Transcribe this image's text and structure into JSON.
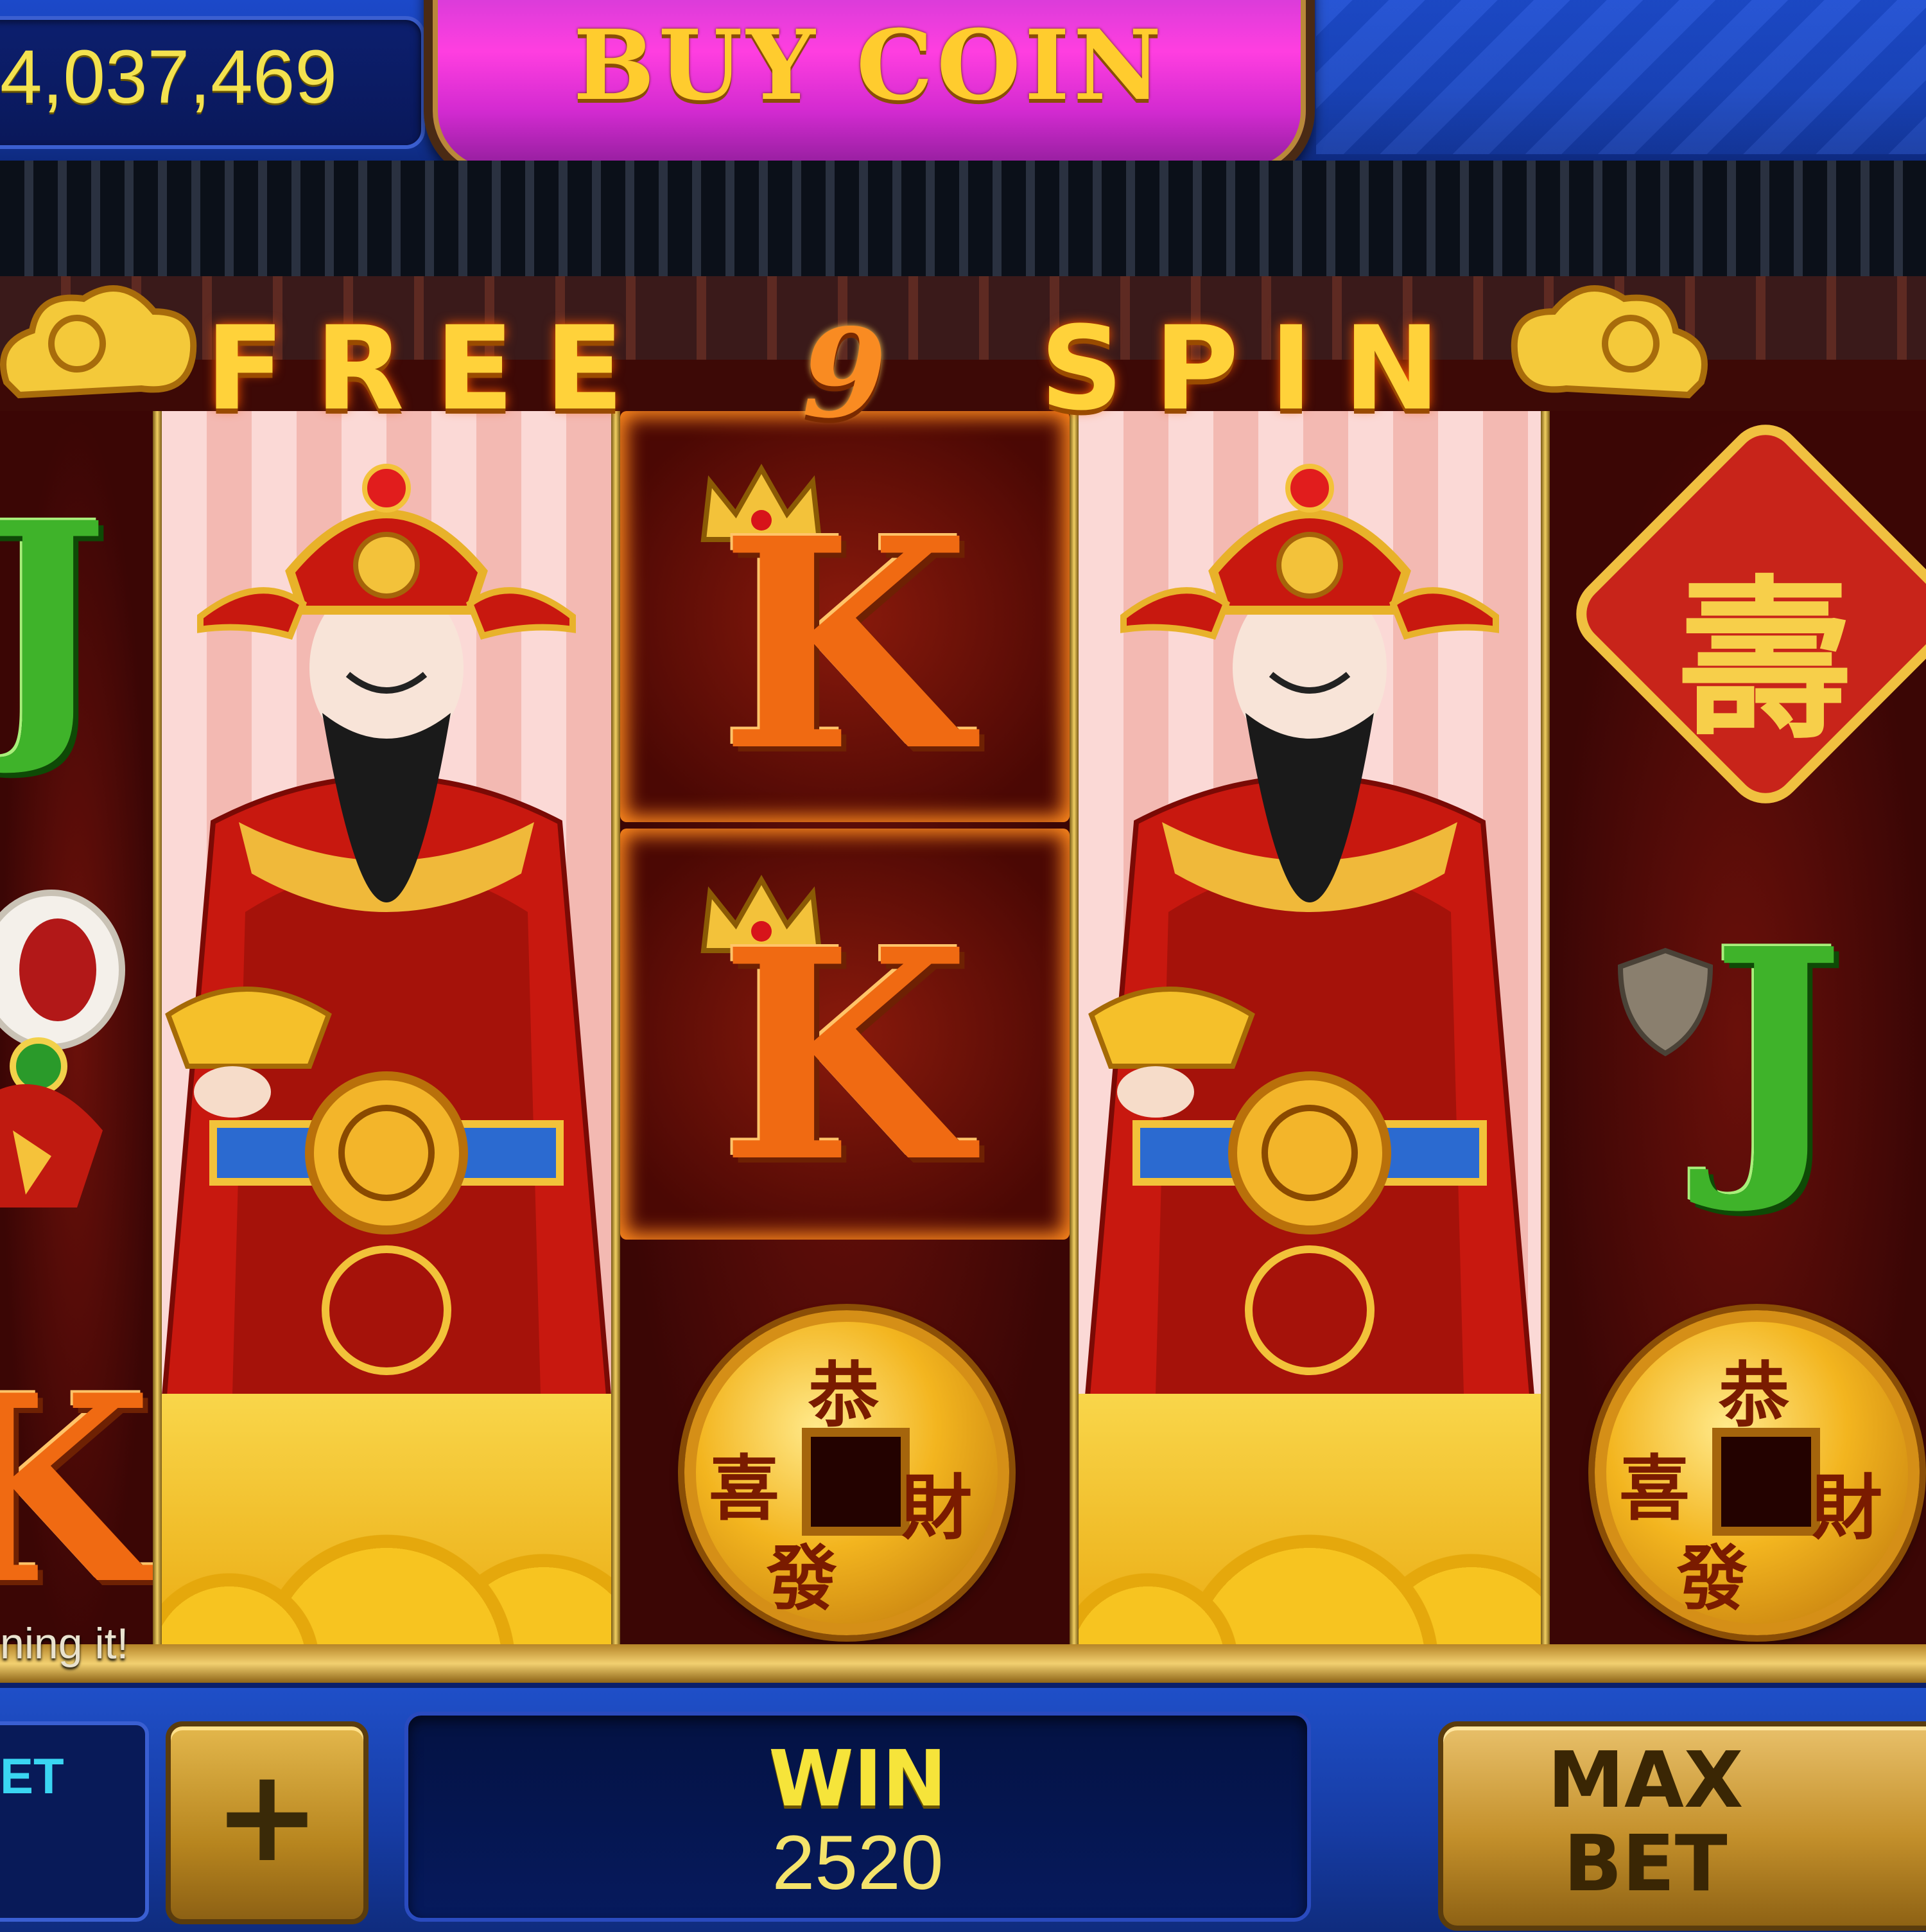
{
  "header": {
    "balance": "4,037,469",
    "buy_coin_label": "BUY COIN"
  },
  "banner": {
    "left_word": "FREE",
    "count": "9",
    "right_word": "SPIN"
  },
  "reels": {
    "reel1": {
      "top_symbol": "J",
      "bottom_symbol": "K"
    },
    "reel3": {
      "top_symbol": "K",
      "middle_symbol": "K",
      "coin_glyphs": [
        "恭",
        "喜",
        "發",
        "財"
      ]
    },
    "reel5": {
      "badge_char": "壽",
      "middle_symbol": "J",
      "coin_glyphs": [
        "恭",
        "喜",
        "發",
        "財"
      ]
    }
  },
  "status_hint": "ning it!",
  "bottom": {
    "bet_label": "ET",
    "plus_label": "+",
    "win_label": "WIN",
    "win_value": "2520",
    "max_bet_label": "MAX BET"
  },
  "colors": {
    "accent_gold": "#ffd23a",
    "buy_coin_magenta": "#ff3ee0",
    "bar_blue": "#1740b3",
    "win_yellow": "#f6e43a"
  }
}
